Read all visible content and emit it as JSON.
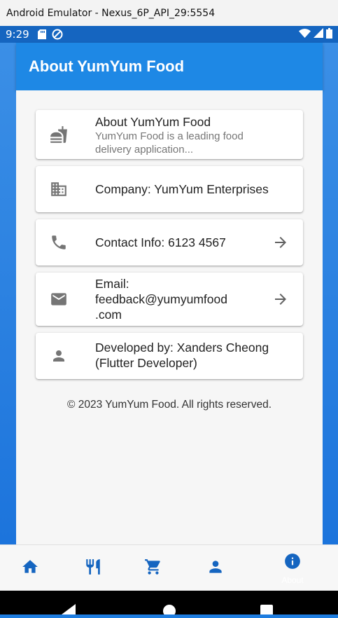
{
  "window": {
    "title": "Android Emulator - Nexus_6P_API_29:5554"
  },
  "status_bar": {
    "time": "9:29"
  },
  "app_bar": {
    "title": "About YumYum Food"
  },
  "cards": [
    {
      "title": "About YumYum Food",
      "subtitle": "YumYum Food is a leading food delivery application...",
      "icon": "fastfood-icon"
    },
    {
      "text": "Company: YumYum Enterprises",
      "icon": "business-icon"
    },
    {
      "text": "Contact Info: 6123 4567",
      "icon": "phone-icon",
      "has_arrow": true
    },
    {
      "text_line1": "Email:",
      "text_line2": "feedback@yumyumfood",
      "text_line3": ".com",
      "icon": "email-icon",
      "has_arrow": true
    },
    {
      "text_line1": "Developed by: Xanders Cheong",
      "text_line2": "(Flutter Developer)",
      "icon": "person-icon"
    }
  ],
  "footer": {
    "text": "© 2023 YumYum Food. All rights reserved."
  },
  "bottom_nav": {
    "items": [
      {
        "icon": "home-icon"
      },
      {
        "icon": "restaurant-icon"
      },
      {
        "icon": "cart-icon"
      },
      {
        "icon": "person-icon"
      },
      {
        "icon": "info-icon",
        "label": "About",
        "selected": true
      }
    ]
  },
  "colors": {
    "primary": "#1e88e5",
    "accent": "#1565c0",
    "icon_grey": "#757575"
  }
}
